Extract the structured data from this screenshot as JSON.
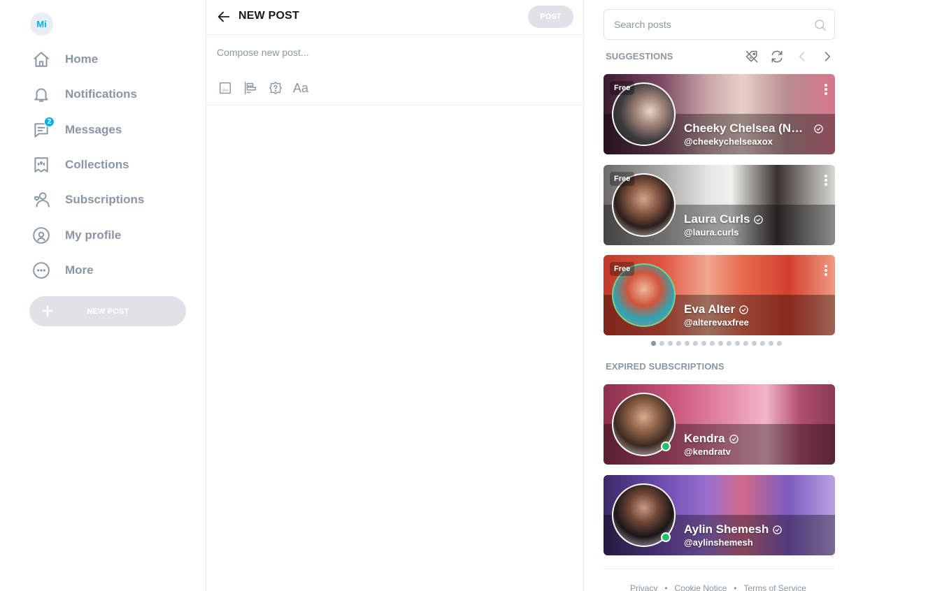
{
  "user": {
    "initials": "Mi"
  },
  "nav": {
    "items": [
      {
        "label": "Home",
        "icon": "home-icon"
      },
      {
        "label": "Notifications",
        "icon": "bell-icon"
      },
      {
        "label": "Messages",
        "icon": "messages-icon",
        "badge": "2"
      },
      {
        "label": "Collections",
        "icon": "collections-icon"
      },
      {
        "label": "Subscriptions",
        "icon": "subscriptions-icon"
      },
      {
        "label": "My profile",
        "icon": "profile-icon"
      },
      {
        "label": "More",
        "icon": "more-icon"
      }
    ],
    "new_post_label": "NEW POST"
  },
  "composer": {
    "title": "NEW POST",
    "post_button": "POST",
    "placeholder": "Compose new post...",
    "tools": [
      "image-icon",
      "poll-icon",
      "quiz-icon",
      "text-format-icon"
    ],
    "text_tool_label": "Aa"
  },
  "search": {
    "placeholder": "Search posts"
  },
  "suggestions": {
    "title": "SUGGESTIONS",
    "free_label": "Free",
    "cards": [
      {
        "name": "Cheeky Chelsea (NSFW)",
        "handle": "@cheekychelseaxox",
        "free": true
      },
      {
        "name": "Laura Curls",
        "handle": "@laura.curls",
        "free": true
      },
      {
        "name": "Eva Alter",
        "handle": "@alterevaxfree",
        "free": true
      }
    ],
    "pages": 16,
    "active_page": 1
  },
  "expired": {
    "title": "EXPIRED SUBSCRIPTIONS",
    "cards": [
      {
        "name": "Kendra",
        "handle": "@kendratv",
        "online": true
      },
      {
        "name": "Aylin Shemesh",
        "handle": "@aylinshemesh",
        "online": true
      }
    ]
  },
  "footer": {
    "links": [
      "Privacy",
      "Cookie Notice",
      "Terms of Service"
    ],
    "separator": "•"
  },
  "colors": {
    "accent": "#00aff0",
    "muted": "#8a96a3",
    "disabled_button": "#dfe3e7",
    "online": "#23c06b"
  }
}
